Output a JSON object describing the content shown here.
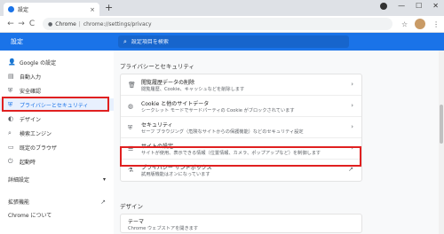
{
  "tab": {
    "title": "設定",
    "close": "×",
    "new_tab": "+"
  },
  "window": {
    "minimize": "—",
    "maximize": "☐",
    "close": "✕"
  },
  "toolbar": {
    "back": "←",
    "forward": "→",
    "reload": "C",
    "site_name": "Chrome",
    "url": "chrome://settings/privacy",
    "star": "☆",
    "menu": "⋮"
  },
  "header": {
    "title": "設定",
    "search_placeholder": "設定項目を検索"
  },
  "sidebar": {
    "items": [
      {
        "icon": "person-icon",
        "glyph": "👤",
        "label": "Google の設定"
      },
      {
        "icon": "autofill-icon",
        "glyph": "▤",
        "label": "自動入力"
      },
      {
        "icon": "shield-check-icon",
        "glyph": "⛨",
        "label": "安全確認"
      },
      {
        "icon": "shield-icon",
        "glyph": "⛨",
        "label": "プライバシーとセキュリティ"
      },
      {
        "icon": "palette-icon",
        "glyph": "◐",
        "label": "デザイン"
      },
      {
        "icon": "search-icon",
        "glyph": "⌕",
        "label": "検索エンジン"
      },
      {
        "icon": "browser-icon",
        "glyph": "▭",
        "label": "既定のブラウザ"
      },
      {
        "icon": "power-icon",
        "glyph": "⏻",
        "label": "起動時"
      }
    ],
    "advanced": {
      "label": "詳細設定",
      "arrow": "▾"
    },
    "extensions": {
      "label": "拡張機能",
      "icon": "↗"
    },
    "about": {
      "label": "Chrome について"
    }
  },
  "main": {
    "section_title": "プライバシーとセキュリティ",
    "rows": [
      {
        "icon": "trash-icon",
        "glyph": "🗑",
        "title": "閲覧履歴データの削除",
        "subtitle": "閲覧履歴、Cookie、キャッシュなどを削除します",
        "arrow": "›"
      },
      {
        "icon": "cookie-icon",
        "glyph": "◍",
        "title": "Cookie と他のサイトデータ",
        "subtitle": "シークレット モードでサードパーティの Cookie がブロックされています",
        "arrow": "›"
      },
      {
        "icon": "security-icon",
        "glyph": "⛨",
        "title": "セキュリティ",
        "subtitle": "セーフ ブラウジング（危険なサイトからの保護機能）などのセキュリティ設定",
        "arrow": "›"
      },
      {
        "icon": "sliders-icon",
        "glyph": "☰",
        "title": "サイトの設定",
        "subtitle": "サイトが使用、表示できる情報（位置情報、カメラ、ポップアップなど）を制御します",
        "arrow": "›"
      },
      {
        "icon": "flask-icon",
        "glyph": "⚗",
        "title": "プライバシー サンドボックス",
        "subtitle": "試用版機能はオンになっています",
        "arrow": "↗"
      }
    ],
    "design_section": "デザイン",
    "theme": {
      "title": "テーマ",
      "subtitle": "Chrome ウェブストアを開きます"
    }
  }
}
